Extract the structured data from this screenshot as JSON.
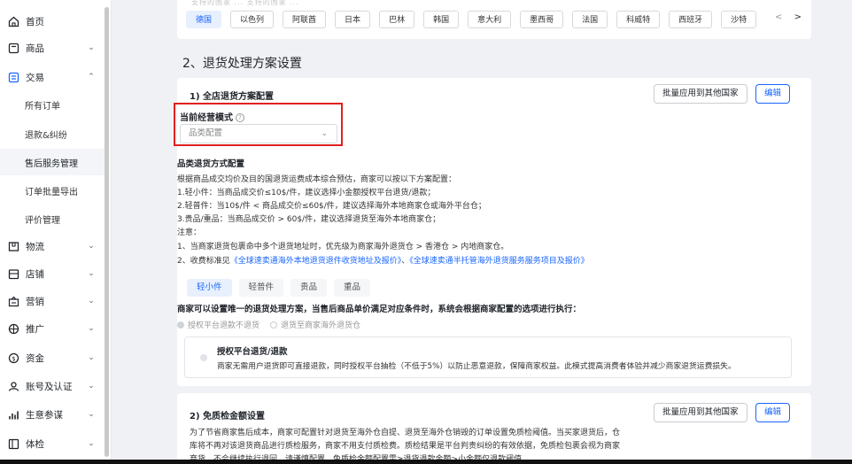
{
  "sidebar": {
    "items": [
      {
        "label": "首页",
        "icon": "home-icon",
        "chevron": ""
      },
      {
        "label": "商品",
        "icon": "product-icon",
        "chevron": "⌄"
      },
      {
        "label": "交易",
        "icon": "trade-icon",
        "chevron": "⌃"
      },
      {
        "label": "物流",
        "icon": "logistics-icon",
        "chevron": "⌄"
      },
      {
        "label": "店铺",
        "icon": "store-icon",
        "chevron": "⌄"
      },
      {
        "label": "营销",
        "icon": "marketing-icon",
        "chevron": "⌄"
      },
      {
        "label": "推广",
        "icon": "promotion-icon",
        "chevron": "⌄"
      },
      {
        "label": "资金",
        "icon": "funds-icon",
        "chevron": "⌄"
      },
      {
        "label": "账号及认证",
        "icon": "account-icon",
        "chevron": "⌄"
      },
      {
        "label": "生意参谋",
        "icon": "analytics-icon",
        "chevron": "⌄"
      },
      {
        "label": "体检",
        "icon": "checkup-icon",
        "chevron": "⌄"
      }
    ],
    "subitems": [
      "所有订单",
      "退款&纠纷",
      "售后服务管理",
      "订单批量导出",
      "评价管理"
    ]
  },
  "top": {
    "faded_text": "支持的国家 ...              支持的国家 ...",
    "countries": [
      "德国",
      "以色列",
      "阿联酋",
      "日本",
      "巴林",
      "韩国",
      "意大利",
      "墨西哥",
      "法国",
      "科威特",
      "西班牙",
      "沙特"
    ],
    "prev": "<",
    "next": ">"
  },
  "section2": {
    "title": "2、退货处理方案设置",
    "store_config": {
      "title": "1) 全店退货方案配置",
      "batch_button": "批量应用到其他国家",
      "edit_button": "编辑",
      "mode_label": "当前经营模式",
      "help": "?",
      "select_value": "品类配置",
      "caret": "⌄"
    },
    "category": {
      "title": "品类退货方式配置",
      "lines": [
        "根据商品成交均价及目的国退货运费成本综合预估，商家可以按以下方案配置：",
        "1.轻小件：当商品成交价≤10$/件，建议选择小金额授权平台退货/退款；",
        "2.轻普件：当10$/件 < 商品成交价≤60$/件，建议选择海外本地商家仓或海外平台仓；",
        "3.贵品/重品：当商品成交价 > 60$/件，建议选择退货至海外本地商家仓；",
        "注意：",
        "1、当商家退货包裹命中多个退货地址时，优先级为商家海外退货仓 > 香港仓 > 内地商家仓。"
      ],
      "fee_prefix": "2、收费标准见",
      "fee_link1": "《全球速卖通海外本地退货退件收货地址及报价》",
      "fee_sep": "、",
      "fee_link2": "《全球速卖通半托管海外退货服务服务项目及报价》"
    },
    "pills": [
      "轻小件",
      "轻普件",
      "贵品",
      "重品"
    ],
    "rule_text": "商家可以设置唯一的退货处理方案，当售后商品单价满足对应条件时，系统会根据商家配置的选项进行执行：",
    "radios": [
      "授权平台退款不退货",
      "退货至商家海外退货仓"
    ],
    "option": {
      "title": "授权平台退货/退款",
      "desc": "商家无需用户退货即可直接退款，同时授权平台抽检（不低于5%）以防止恶意退款，保障商家权益。此模式提高消费者体验并减少商家退货运费损失。"
    }
  },
  "inspection": {
    "title": "2) 免质检金额设置",
    "batch_button": "批量应用到其他国家",
    "edit_button": "编辑",
    "lines": [
      "为了节省商家售后成本，商家可配置针对退货至海外仓自提、退货至海外仓销毁的订单设置免质检阈值。当买家退货后，仓",
      "库将不再对该退货商品进行质检服务，商家不用支付质检费。质检结果是平台判责纠纷的有效依据，免质检包裹会视为商家",
      "弃货，不会继续执行退回。请谨慎配置。免质检金额配置需≥退货退款金额>小金额仅退款阈值"
    ]
  },
  "colors": {
    "accent": "#1966ff",
    "highlight": "#e02020"
  }
}
